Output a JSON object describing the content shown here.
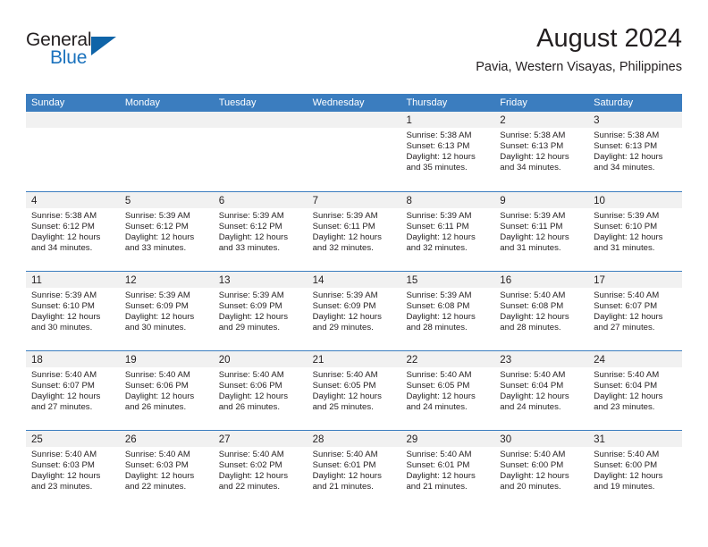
{
  "brand": {
    "name_top": "General",
    "name_bottom": "Blue",
    "triangle_icon": "blue-triangle-logo",
    "colors": {
      "blue": "#1b72bd",
      "triangle": "#0f64a8",
      "dark": "#231f20"
    }
  },
  "header": {
    "title": "August 2024",
    "subtitle": "Pavia, Western Visayas, Philippines"
  },
  "theme": {
    "header_row_bg": "#3b7dbf",
    "day_band_bg": "#f1f1f1",
    "row_divider": "#3b7dbf"
  },
  "weekdays": [
    "Sunday",
    "Monday",
    "Tuesday",
    "Wednesday",
    "Thursday",
    "Friday",
    "Saturday"
  ],
  "weeks": [
    [
      {
        "day": "",
        "empty": true
      },
      {
        "day": "",
        "empty": true
      },
      {
        "day": "",
        "empty": true
      },
      {
        "day": "",
        "empty": true
      },
      {
        "day": "1",
        "sunrise": "Sunrise: 5:38 AM",
        "sunset": "Sunset: 6:13 PM",
        "daylight_line1": "Daylight: 12 hours",
        "daylight_line2": "and 35 minutes."
      },
      {
        "day": "2",
        "sunrise": "Sunrise: 5:38 AM",
        "sunset": "Sunset: 6:13 PM",
        "daylight_line1": "Daylight: 12 hours",
        "daylight_line2": "and 34 minutes."
      },
      {
        "day": "3",
        "sunrise": "Sunrise: 5:38 AM",
        "sunset": "Sunset: 6:13 PM",
        "daylight_line1": "Daylight: 12 hours",
        "daylight_line2": "and 34 minutes."
      }
    ],
    [
      {
        "day": "4",
        "sunrise": "Sunrise: 5:38 AM",
        "sunset": "Sunset: 6:12 PM",
        "daylight_line1": "Daylight: 12 hours",
        "daylight_line2": "and 34 minutes."
      },
      {
        "day": "5",
        "sunrise": "Sunrise: 5:39 AM",
        "sunset": "Sunset: 6:12 PM",
        "daylight_line1": "Daylight: 12 hours",
        "daylight_line2": "and 33 minutes."
      },
      {
        "day": "6",
        "sunrise": "Sunrise: 5:39 AM",
        "sunset": "Sunset: 6:12 PM",
        "daylight_line1": "Daylight: 12 hours",
        "daylight_line2": "and 33 minutes."
      },
      {
        "day": "7",
        "sunrise": "Sunrise: 5:39 AM",
        "sunset": "Sunset: 6:11 PM",
        "daylight_line1": "Daylight: 12 hours",
        "daylight_line2": "and 32 minutes."
      },
      {
        "day": "8",
        "sunrise": "Sunrise: 5:39 AM",
        "sunset": "Sunset: 6:11 PM",
        "daylight_line1": "Daylight: 12 hours",
        "daylight_line2": "and 32 minutes."
      },
      {
        "day": "9",
        "sunrise": "Sunrise: 5:39 AM",
        "sunset": "Sunset: 6:11 PM",
        "daylight_line1": "Daylight: 12 hours",
        "daylight_line2": "and 31 minutes."
      },
      {
        "day": "10",
        "sunrise": "Sunrise: 5:39 AM",
        "sunset": "Sunset: 6:10 PM",
        "daylight_line1": "Daylight: 12 hours",
        "daylight_line2": "and 31 minutes."
      }
    ],
    [
      {
        "day": "11",
        "sunrise": "Sunrise: 5:39 AM",
        "sunset": "Sunset: 6:10 PM",
        "daylight_line1": "Daylight: 12 hours",
        "daylight_line2": "and 30 minutes."
      },
      {
        "day": "12",
        "sunrise": "Sunrise: 5:39 AM",
        "sunset": "Sunset: 6:09 PM",
        "daylight_line1": "Daylight: 12 hours",
        "daylight_line2": "and 30 minutes."
      },
      {
        "day": "13",
        "sunrise": "Sunrise: 5:39 AM",
        "sunset": "Sunset: 6:09 PM",
        "daylight_line1": "Daylight: 12 hours",
        "daylight_line2": "and 29 minutes."
      },
      {
        "day": "14",
        "sunrise": "Sunrise: 5:39 AM",
        "sunset": "Sunset: 6:09 PM",
        "daylight_line1": "Daylight: 12 hours",
        "daylight_line2": "and 29 minutes."
      },
      {
        "day": "15",
        "sunrise": "Sunrise: 5:39 AM",
        "sunset": "Sunset: 6:08 PM",
        "daylight_line1": "Daylight: 12 hours",
        "daylight_line2": "and 28 minutes."
      },
      {
        "day": "16",
        "sunrise": "Sunrise: 5:40 AM",
        "sunset": "Sunset: 6:08 PM",
        "daylight_line1": "Daylight: 12 hours",
        "daylight_line2": "and 28 minutes."
      },
      {
        "day": "17",
        "sunrise": "Sunrise: 5:40 AM",
        "sunset": "Sunset: 6:07 PM",
        "daylight_line1": "Daylight: 12 hours",
        "daylight_line2": "and 27 minutes."
      }
    ],
    [
      {
        "day": "18",
        "sunrise": "Sunrise: 5:40 AM",
        "sunset": "Sunset: 6:07 PM",
        "daylight_line1": "Daylight: 12 hours",
        "daylight_line2": "and 27 minutes."
      },
      {
        "day": "19",
        "sunrise": "Sunrise: 5:40 AM",
        "sunset": "Sunset: 6:06 PM",
        "daylight_line1": "Daylight: 12 hours",
        "daylight_line2": "and 26 minutes."
      },
      {
        "day": "20",
        "sunrise": "Sunrise: 5:40 AM",
        "sunset": "Sunset: 6:06 PM",
        "daylight_line1": "Daylight: 12 hours",
        "daylight_line2": "and 26 minutes."
      },
      {
        "day": "21",
        "sunrise": "Sunrise: 5:40 AM",
        "sunset": "Sunset: 6:05 PM",
        "daylight_line1": "Daylight: 12 hours",
        "daylight_line2": "and 25 minutes."
      },
      {
        "day": "22",
        "sunrise": "Sunrise: 5:40 AM",
        "sunset": "Sunset: 6:05 PM",
        "daylight_line1": "Daylight: 12 hours",
        "daylight_line2": "and 24 minutes."
      },
      {
        "day": "23",
        "sunrise": "Sunrise: 5:40 AM",
        "sunset": "Sunset: 6:04 PM",
        "daylight_line1": "Daylight: 12 hours",
        "daylight_line2": "and 24 minutes."
      },
      {
        "day": "24",
        "sunrise": "Sunrise: 5:40 AM",
        "sunset": "Sunset: 6:04 PM",
        "daylight_line1": "Daylight: 12 hours",
        "daylight_line2": "and 23 minutes."
      }
    ],
    [
      {
        "day": "25",
        "sunrise": "Sunrise: 5:40 AM",
        "sunset": "Sunset: 6:03 PM",
        "daylight_line1": "Daylight: 12 hours",
        "daylight_line2": "and 23 minutes."
      },
      {
        "day": "26",
        "sunrise": "Sunrise: 5:40 AM",
        "sunset": "Sunset: 6:03 PM",
        "daylight_line1": "Daylight: 12 hours",
        "daylight_line2": "and 22 minutes."
      },
      {
        "day": "27",
        "sunrise": "Sunrise: 5:40 AM",
        "sunset": "Sunset: 6:02 PM",
        "daylight_line1": "Daylight: 12 hours",
        "daylight_line2": "and 22 minutes."
      },
      {
        "day": "28",
        "sunrise": "Sunrise: 5:40 AM",
        "sunset": "Sunset: 6:01 PM",
        "daylight_line1": "Daylight: 12 hours",
        "daylight_line2": "and 21 minutes."
      },
      {
        "day": "29",
        "sunrise": "Sunrise: 5:40 AM",
        "sunset": "Sunset: 6:01 PM",
        "daylight_line1": "Daylight: 12 hours",
        "daylight_line2": "and 21 minutes."
      },
      {
        "day": "30",
        "sunrise": "Sunrise: 5:40 AM",
        "sunset": "Sunset: 6:00 PM",
        "daylight_line1": "Daylight: 12 hours",
        "daylight_line2": "and 20 minutes."
      },
      {
        "day": "31",
        "sunrise": "Sunrise: 5:40 AM",
        "sunset": "Sunset: 6:00 PM",
        "daylight_line1": "Daylight: 12 hours",
        "daylight_line2": "and 19 minutes."
      }
    ]
  ]
}
